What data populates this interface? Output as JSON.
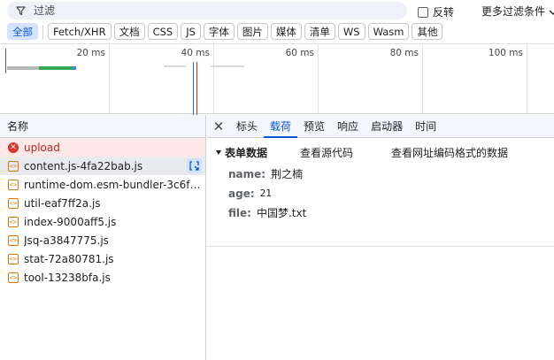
{
  "filter": {
    "placeholder": "过滤",
    "invert_label": "反转",
    "more_filters_label": "更多过滤条件"
  },
  "types": [
    "全部",
    "Fetch/XHR",
    "文档",
    "CSS",
    "JS",
    "字体",
    "图片",
    "媒体",
    "清单",
    "WS",
    "Wasm",
    "其他"
  ],
  "timeline": {
    "ticks": [
      "20 ms",
      "40 ms",
      "60 ms",
      "80 ms",
      "100 ms"
    ]
  },
  "requests": {
    "header": "名称",
    "rows": [
      {
        "name": "upload",
        "status": "error"
      },
      {
        "name": "content.js-4fa22bab.js",
        "status": "selected"
      },
      {
        "name": "runtime-dom.esm-bundler-3c6fc...",
        "status": "normal"
      },
      {
        "name": "util-eaf7ff2a.js",
        "status": "normal"
      },
      {
        "name": "index-9000aff5.js",
        "status": "normal"
      },
      {
        "name": "Jsq-a3847775.js",
        "status": "normal"
      },
      {
        "name": "stat-72a80781.js",
        "status": "normal"
      },
      {
        "name": "tool-13238bfa.js",
        "status": "normal"
      }
    ]
  },
  "detail": {
    "tabs": [
      "标头",
      "载荷",
      "预览",
      "响应",
      "启动器",
      "时间"
    ],
    "active_tab": "载荷",
    "section_title": "表单数据",
    "view_source": "查看源代码",
    "view_url_encoded": "查看网址编码格式的数据",
    "fields": [
      {
        "key": "name:",
        "value": "荆之楠"
      },
      {
        "key": "age:",
        "value": "21"
      },
      {
        "key": "file:",
        "value": "中国梦.txt"
      }
    ]
  },
  "colors": {
    "accent": "#0b57d0",
    "error": "#dc362e",
    "js_orange": "#e37400"
  }
}
